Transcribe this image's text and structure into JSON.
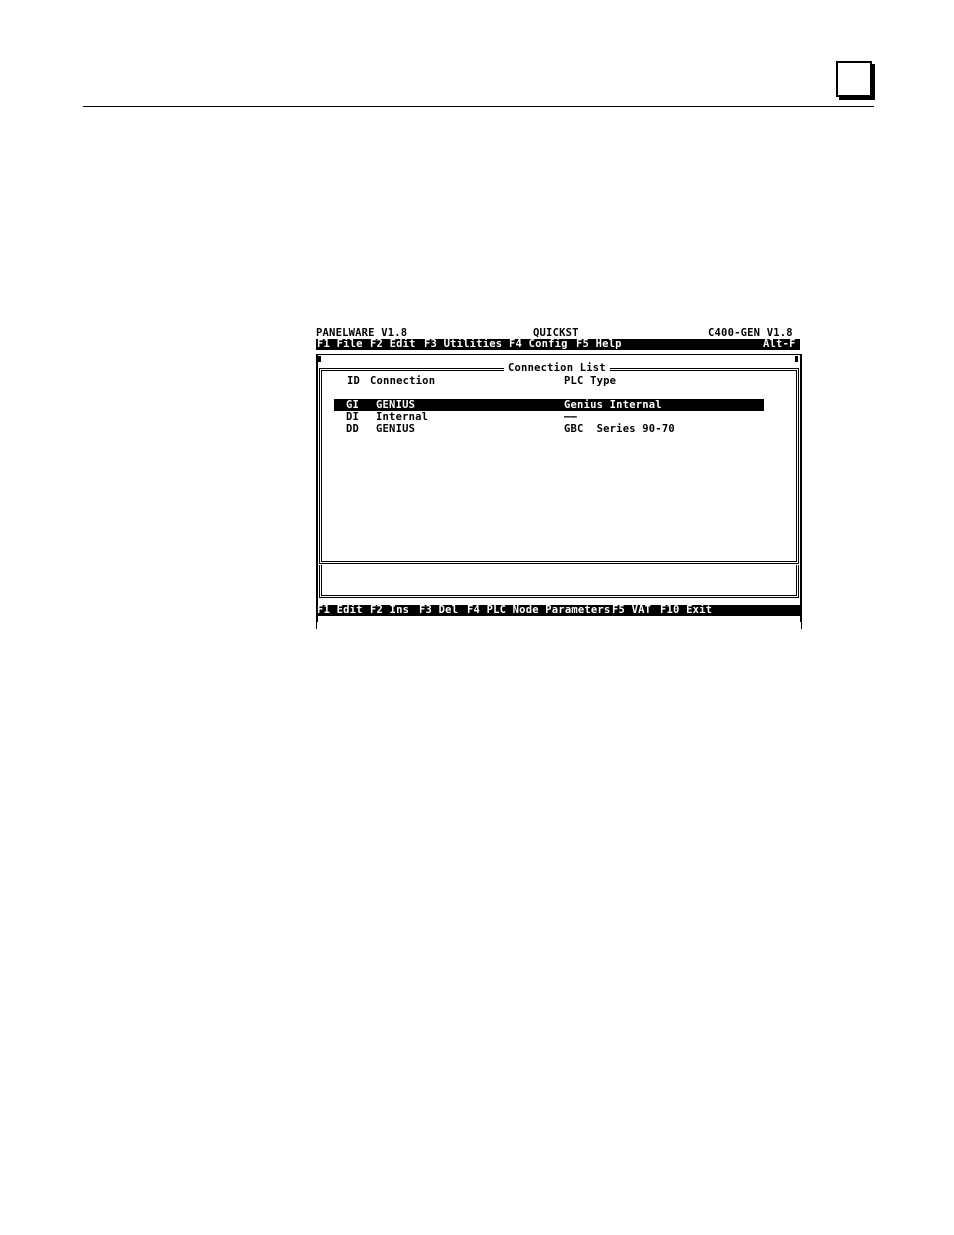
{
  "page": {
    "corner_marker": ""
  },
  "screen": {
    "title_left": "PANELWARE V1.8",
    "title_center": "QUICKST",
    "title_right": "C400-GEN V1.8",
    "menu": [
      {
        "label": "F1 File"
      },
      {
        "label": "F2 Edit"
      },
      {
        "label": "F3 Utilities"
      },
      {
        "label": "F4 Config"
      },
      {
        "label": "F5 Help"
      }
    ],
    "menu_shortcut": "Alt-F",
    "dialog_title": "Connection List",
    "columns": {
      "id": "ID",
      "connection": "Connection",
      "plc_type": "PLC Type"
    },
    "rows": [
      {
        "id": "GI",
        "connection": "GENIUS",
        "plc_type": "Genius Internal",
        "selected": true
      },
      {
        "id": "DI",
        "connection": "Internal",
        "plc_type": "——",
        "selected": false
      },
      {
        "id": "DD",
        "connection": "GENIUS",
        "plc_type": "GBC  Series 90-70",
        "selected": false
      }
    ],
    "function_keys": [
      {
        "label": "F1 Edit"
      },
      {
        "label": "F2 Ins"
      },
      {
        "label": "F3 Del"
      },
      {
        "label": "F4 PLC Node Parameters"
      },
      {
        "label": "F5 VAT"
      },
      {
        "label": "F10 Exit"
      }
    ]
  }
}
